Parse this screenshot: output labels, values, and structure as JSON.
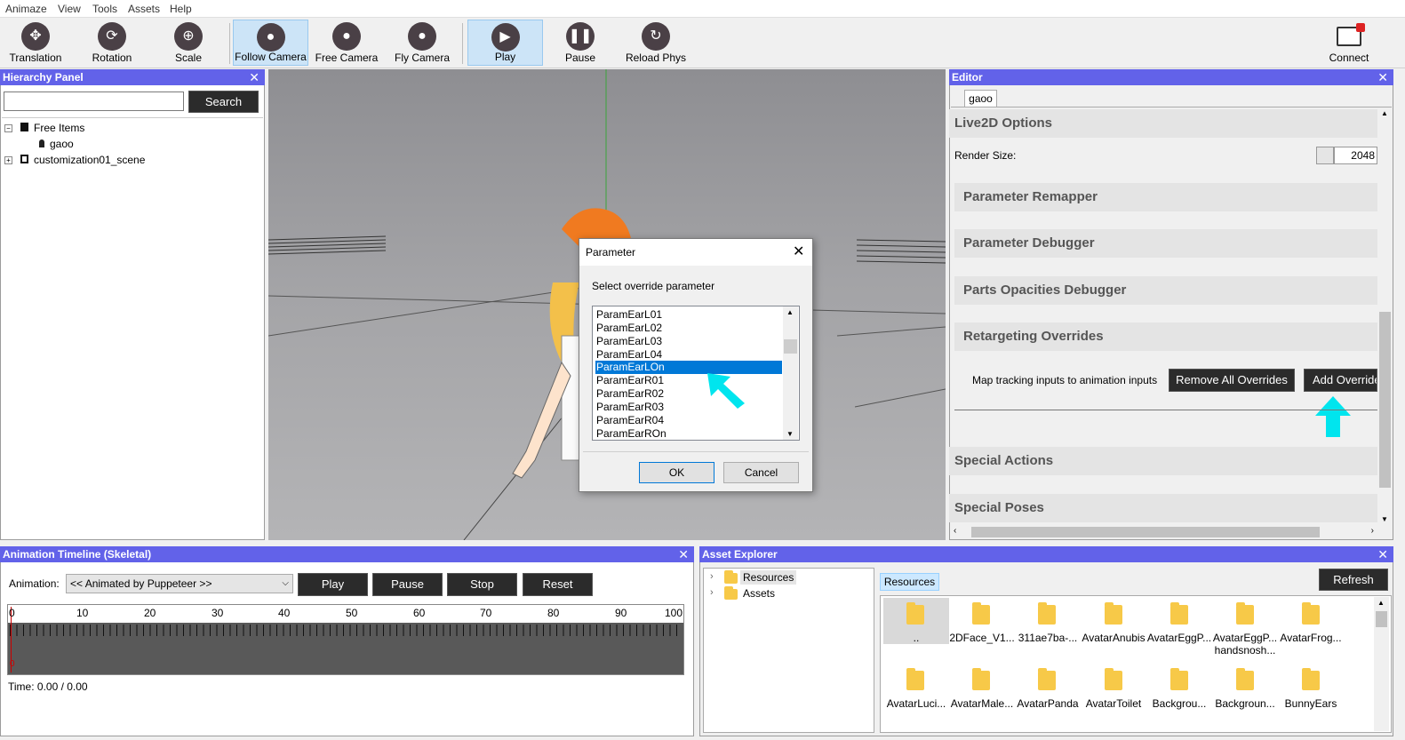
{
  "menu": [
    "Animaze",
    "View",
    "Tools",
    "Assets",
    "Help"
  ],
  "toolbar": {
    "translation": "Translation",
    "rotation": "Rotation",
    "scale": "Scale",
    "follow_camera": "Follow Camera",
    "free_camera": "Free Camera",
    "fly_camera": "Fly Camera",
    "play": "Play",
    "pause": "Pause",
    "reload_phys": "Reload Phys",
    "connect": "Connect"
  },
  "hierarchy": {
    "title": "Hierarchy Panel",
    "search_label": "Search",
    "search_value": "",
    "items": [
      "Free Items",
      "gaoo",
      "customization01_scene"
    ]
  },
  "dialog": {
    "title": "Parameter",
    "prompt": "Select override parameter",
    "options": [
      "ParamEarL01",
      "ParamEarL02",
      "ParamEarL03",
      "ParamEarL04",
      "ParamEarLOn",
      "ParamEarR01",
      "ParamEarR02",
      "ParamEarR03",
      "ParamEarR04",
      "ParamEarROn"
    ],
    "selected": "ParamEarLOn",
    "ok": "OK",
    "cancel": "Cancel"
  },
  "editor": {
    "title": "Editor",
    "tab": "gaoo",
    "live2d_options": "Live2D Options",
    "render_size_label": "Render Size:",
    "render_size_value": "2048",
    "sections": [
      "Parameter Remapper",
      "Parameter Debugger",
      "Parts Opacities Debugger",
      "Retargeting Overrides"
    ],
    "map_text": "Map tracking inputs to animation inputs",
    "remove_all": "Remove All Overrides",
    "add_override": "Add Override",
    "special_actions": "Special Actions",
    "special_poses": "Special Poses"
  },
  "timeline": {
    "title": "Animation Timeline (Skeletal)",
    "animation_label": "Animation:",
    "animation_value": "<< Animated by Puppeteer >>",
    "play": "Play",
    "pause": "Pause",
    "stop": "Stop",
    "reset": "Reset",
    "ticks": [
      "0",
      "10",
      "20",
      "30",
      "40",
      "50",
      "60",
      "70",
      "80",
      "90",
      "100"
    ],
    "marker": "0",
    "time": "Time: 0.00 / 0.00"
  },
  "assets": {
    "title": "Asset Explorer",
    "tree": [
      "Resources",
      "Assets"
    ],
    "tab": "Resources",
    "refresh": "Refresh",
    "row1": [
      "..",
      "2DFace_V1...",
      "311ae7ba-...",
      "AvatarAnubis",
      "AvatarEggP...",
      "AvatarEggP... handsnosh...",
      "AvatarFrog..."
    ],
    "row2": [
      "AvatarLuci...",
      "AvatarMale...",
      "AvatarPanda",
      "AvatarToilet",
      "Backgrou...",
      "Backgroun...",
      "BunnyEars"
    ]
  }
}
